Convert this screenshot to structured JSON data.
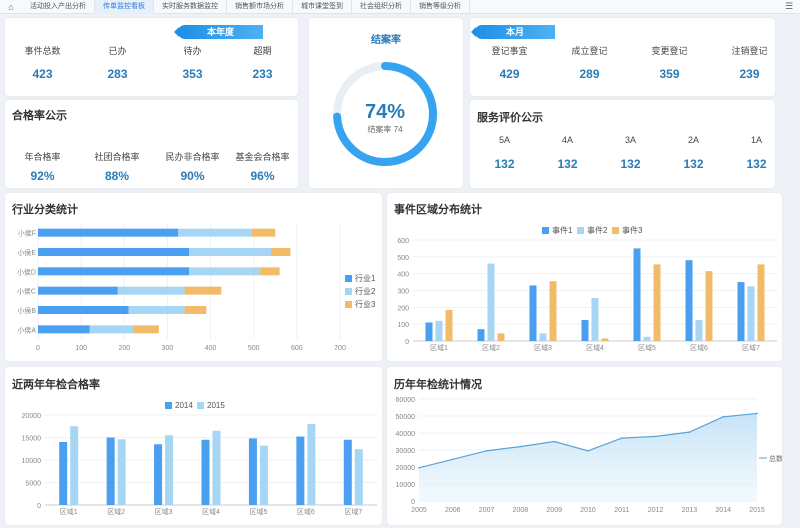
{
  "nav": {
    "tabs": [
      "活动投入产出分析",
      "传单监控看板",
      "实时服务数据监控",
      "销售额市场分析",
      "城市课堂签到",
      "社会组织分析",
      "销售等级分析"
    ],
    "active_index": 1
  },
  "annual": {
    "ribbon": "本年度",
    "stats": [
      {
        "label": "事件总数",
        "value": "423"
      },
      {
        "label": "已办",
        "value": "283"
      },
      {
        "label": "待办",
        "value": "353"
      },
      {
        "label": "超期",
        "value": "233"
      }
    ]
  },
  "pass_rate": {
    "title": "合格率公示",
    "stats": [
      {
        "label": "年合格率",
        "value": "92%"
      },
      {
        "label": "社团合格率",
        "value": "88%"
      },
      {
        "label": "民办非合格率",
        "value": "90%"
      },
      {
        "label": "基金会合格率",
        "value": "96%"
      }
    ]
  },
  "closure": {
    "title": "结案率",
    "percent_text": "74%",
    "sub_label": "结案率 74",
    "percent": 74,
    "ring_color": "#36a3f0",
    "track_color": "#e8eef4"
  },
  "monthly": {
    "ribbon": "本月",
    "stats": [
      {
        "label": "登记事宜",
        "value": "429"
      },
      {
        "label": "成立登记",
        "value": "289"
      },
      {
        "label": "变更登记",
        "value": "359"
      },
      {
        "label": "注销登记",
        "value": "239"
      }
    ]
  },
  "service": {
    "title": "服务评价公示",
    "stats": [
      {
        "label": "5A",
        "value": "132"
      },
      {
        "label": "4A",
        "value": "132"
      },
      {
        "label": "3A",
        "value": "132"
      },
      {
        "label": "2A",
        "value": "132"
      },
      {
        "label": "1A",
        "value": "132"
      }
    ]
  },
  "colors": {
    "blue": "#4a9ff0",
    "light_blue": "#a7d6f5",
    "orange": "#f2bb6a",
    "line": "#5aa3d6"
  },
  "industry": {
    "title": "行业分类统计",
    "chart_data": {
      "type": "bar",
      "orientation": "horizontal",
      "stacked": true,
      "categories": [
        "小侯A",
        "小侯B",
        "小侯C",
        "小侯D",
        "小侯E",
        "小侯F"
      ],
      "series": [
        {
          "name": "行业1",
          "values": [
            120,
            210,
            185,
            350,
            350,
            325
          ]
        },
        {
          "name": "行业2",
          "values": [
            100,
            130,
            155,
            165,
            190,
            170
          ]
        },
        {
          "name": "行业3",
          "values": [
            60,
            50,
            85,
            45,
            45,
            55
          ]
        }
      ],
      "xticks": [
        0,
        100,
        200,
        300,
        400,
        500,
        600,
        700
      ],
      "xlim": [
        0,
        700
      ],
      "legend": "right"
    }
  },
  "region_events": {
    "title": "事件区域分布统计",
    "chart_data": {
      "type": "bar",
      "categories": [
        "区域1",
        "区域2",
        "区域3",
        "区域4",
        "区域5",
        "区域6",
        "区域7"
      ],
      "series": [
        {
          "name": "事件1",
          "values": [
            110,
            70,
            330,
            125,
            550,
            480,
            350
          ]
        },
        {
          "name": "事件2",
          "values": [
            120,
            460,
            45,
            255,
            25,
            125,
            325
          ]
        },
        {
          "name": "事件3",
          "values": [
            185,
            45,
            355,
            15,
            455,
            415,
            455
          ]
        }
      ],
      "yticks": [
        0,
        100,
        200,
        300,
        400,
        500,
        600
      ],
      "ylim": [
        0,
        600
      ],
      "legend": "top"
    }
  },
  "two_year": {
    "title": "近两年年检合格率",
    "chart_data": {
      "type": "bar",
      "categories": [
        "区域1",
        "区域2",
        "区域3",
        "区域4",
        "区域5",
        "区域6",
        "区域7"
      ],
      "series": [
        {
          "name": "2014",
          "values": [
            14000,
            15000,
            13500,
            14500,
            14800,
            15200,
            14500
          ]
        },
        {
          "name": "2015",
          "values": [
            17500,
            14600,
            15500,
            16500,
            13200,
            18000,
            12400
          ]
        }
      ],
      "yticks": [
        0,
        5000,
        10000,
        15000,
        20000
      ],
      "ylim": [
        0,
        20000
      ],
      "legend": "top"
    }
  },
  "history": {
    "title": "历年年检统计情况",
    "chart_data": {
      "type": "area",
      "x": [
        "2005",
        "2006",
        "2007",
        "2008",
        "2009",
        "2010",
        "2011",
        "2012",
        "2013",
        "2014",
        "2015"
      ],
      "series": [
        {
          "name": "总数",
          "values": [
            19500,
            24500,
            29500,
            32000,
            35000,
            29500,
            37000,
            38000,
            40500,
            49500,
            51500
          ]
        }
      ],
      "yticks": [
        0,
        10000,
        20000,
        30000,
        40000,
        50000,
        60000
      ],
      "ylim": [
        0,
        60000
      ],
      "legend": "right"
    }
  }
}
